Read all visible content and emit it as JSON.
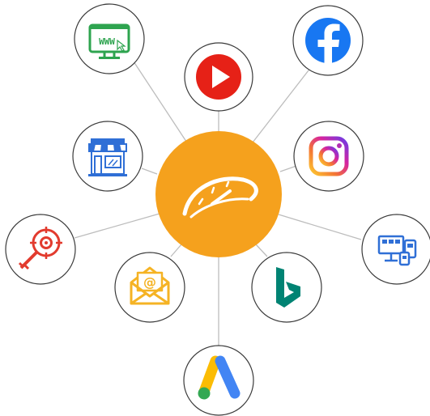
{
  "hub": {
    "icon": "orange-speedometer-logo-icon",
    "color": "#f5a11d"
  },
  "nodes": [
    {
      "icon": "website-www-icon",
      "label": "WWW",
      "color": "#2ea44f"
    },
    {
      "icon": "youtube-icon",
      "color": "#e62117"
    },
    {
      "icon": "facebook-icon",
      "color": "#1877f2"
    },
    {
      "icon": "storefront-icon",
      "color": "#2f6fd6"
    },
    {
      "icon": "instagram-icon",
      "color": "#d6249f"
    },
    {
      "icon": "keyword-target-icon",
      "color": "#e23b2e"
    },
    {
      "icon": "email-icon",
      "color": "#f5b324"
    },
    {
      "icon": "bing-icon",
      "color": "#008373"
    },
    {
      "icon": "multi-device-display-icon",
      "color": "#2f6fd6"
    },
    {
      "icon": "google-ads-icon",
      "colors": [
        "#fbbc04",
        "#4285f4",
        "#34a853"
      ]
    }
  ]
}
